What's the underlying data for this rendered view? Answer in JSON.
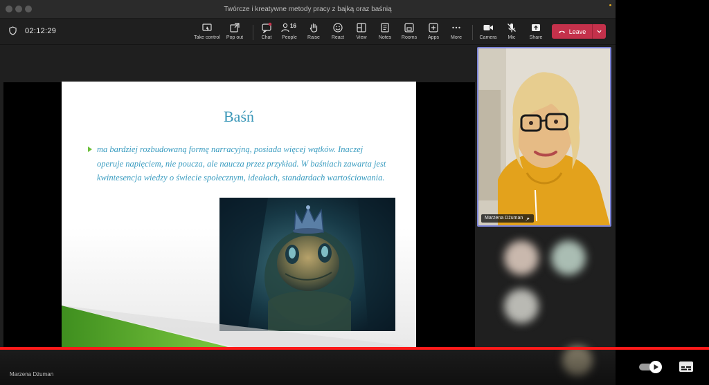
{
  "window": {
    "title": "Twórcze i kreatywne metody pracy z bajką oraz baśnią"
  },
  "toolbar": {
    "timer": "02:12:29",
    "buttons": [
      {
        "id": "take-control",
        "label": "Take control",
        "icon": "take-control-icon"
      },
      {
        "id": "pop-out",
        "label": "Pop out",
        "icon": "pop-out-icon"
      },
      {
        "id": "chat",
        "label": "Chat",
        "icon": "chat-icon"
      },
      {
        "id": "people",
        "label": "People",
        "icon": "people-icon",
        "count": "16"
      },
      {
        "id": "raise",
        "label": "Raise",
        "icon": "hand-icon"
      },
      {
        "id": "react",
        "label": "React",
        "icon": "smiley-icon"
      },
      {
        "id": "view",
        "label": "View",
        "icon": "view-icon"
      },
      {
        "id": "notes",
        "label": "Notes",
        "icon": "notes-icon"
      },
      {
        "id": "rooms",
        "label": "Rooms",
        "icon": "rooms-icon"
      },
      {
        "id": "apps",
        "label": "Apps",
        "icon": "plus-icon"
      },
      {
        "id": "more",
        "label": "More",
        "icon": "more-icon"
      },
      {
        "id": "camera",
        "label": "Camera",
        "icon": "camera-icon"
      },
      {
        "id": "mic",
        "label": "Mic",
        "icon": "mic-muted-icon"
      },
      {
        "id": "share",
        "label": "Share",
        "icon": "share-icon"
      }
    ],
    "leave_label": "Leave"
  },
  "slide": {
    "title": "Baśń",
    "body": "ma bardziej rozbudowaną formę narracyjną, posiada więcej wątków. Inaczej operuje napięciem, nie poucza, ale naucza przez przykład. W baśniach zawarta jest kwintesencja wiedzy o świecie społecznym, ideałach, standardach wartościowania."
  },
  "participants": {
    "pinned_name": "Marzena Dżuman"
  },
  "player": {
    "presenter_name": "Marzena Dżuman"
  },
  "colors": {
    "accent_leave": "#c4314b",
    "slide_title": "#3a97b8",
    "progress": "#ff1a1a",
    "tile_border": "#7b83d8"
  }
}
